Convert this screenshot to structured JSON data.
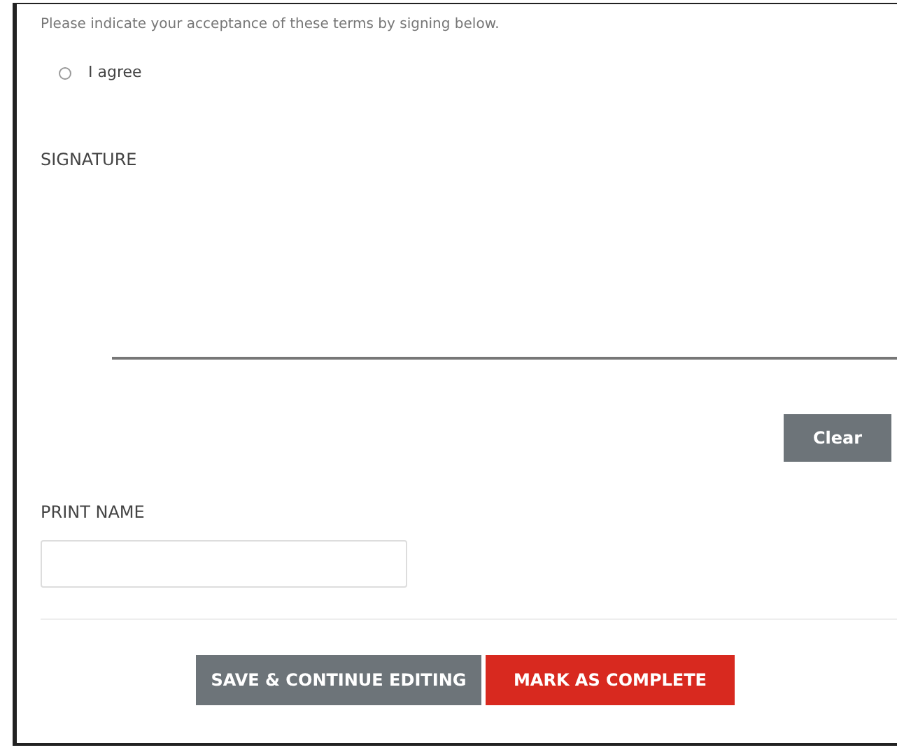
{
  "instructions": "Please indicate your acceptance of these terms by signing below.",
  "agreement": {
    "label": "I agree",
    "selected": false
  },
  "signature": {
    "label": "SIGNATURE",
    "clear_button": "Clear"
  },
  "print_name": {
    "label": "PRINT NAME"
  },
  "buttons": [
    {
      "label": "SAVE & CONTINUE EDITING",
      "kind": "secondary"
    },
    {
      "label": "MARK AS COMPLETE",
      "kind": "primary"
    }
  ]
}
